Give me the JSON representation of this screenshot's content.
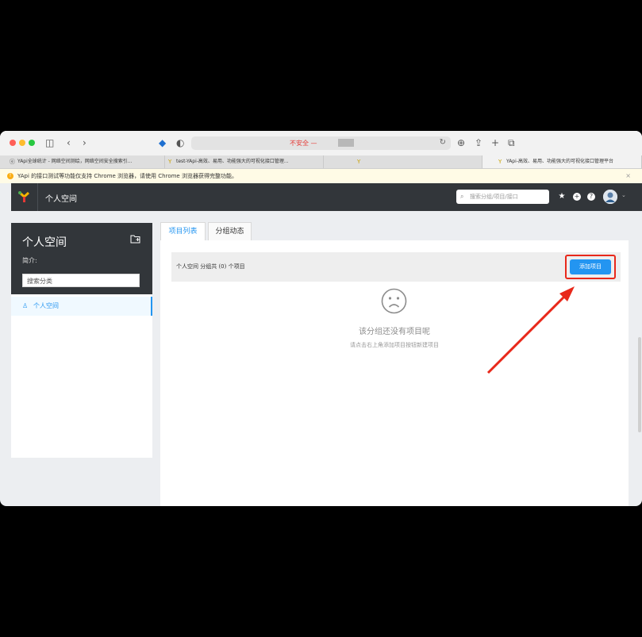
{
  "browser": {
    "url_warning": "不安全 —",
    "tabs": [
      {
        "label": "YApi全球统计 - 网络空间测绘，网络空间安全搜索引..."
      },
      {
        "label": "test-YApi-高效、易用、功能强大的可视化接口管理..."
      },
      {
        "label": ""
      },
      {
        "label": "YApi-高效、易用、功能强大的可视化接口管理平台"
      }
    ]
  },
  "notice": {
    "message": "YApi 的接口测试等功能仅支持 Chrome 浏览器，请使用 Chrome 浏览器获得完整功能。",
    "close": "×"
  },
  "header": {
    "title": "个人空间",
    "search_placeholder": "搜索分组/项目/接口"
  },
  "sidebar": {
    "title": "个人空间",
    "intro": "简介:",
    "search_value": "搜索分类",
    "items": [
      {
        "label": "个人空间"
      }
    ]
  },
  "main": {
    "tabs": [
      {
        "label": "项目列表"
      },
      {
        "label": "分组动态"
      }
    ],
    "bar_label": "个人空间 分组共 (0) 个项目",
    "add_button": "添加项目",
    "empty_title": "该分组还没有项目呢",
    "empty_subtitle": "请点击右上角添加项目按钮新建项目"
  },
  "colors": {
    "accent": "#2395f1",
    "header_bg": "#32363a",
    "annotation_red": "#e8281a",
    "warning_yellow": "#faad14"
  }
}
